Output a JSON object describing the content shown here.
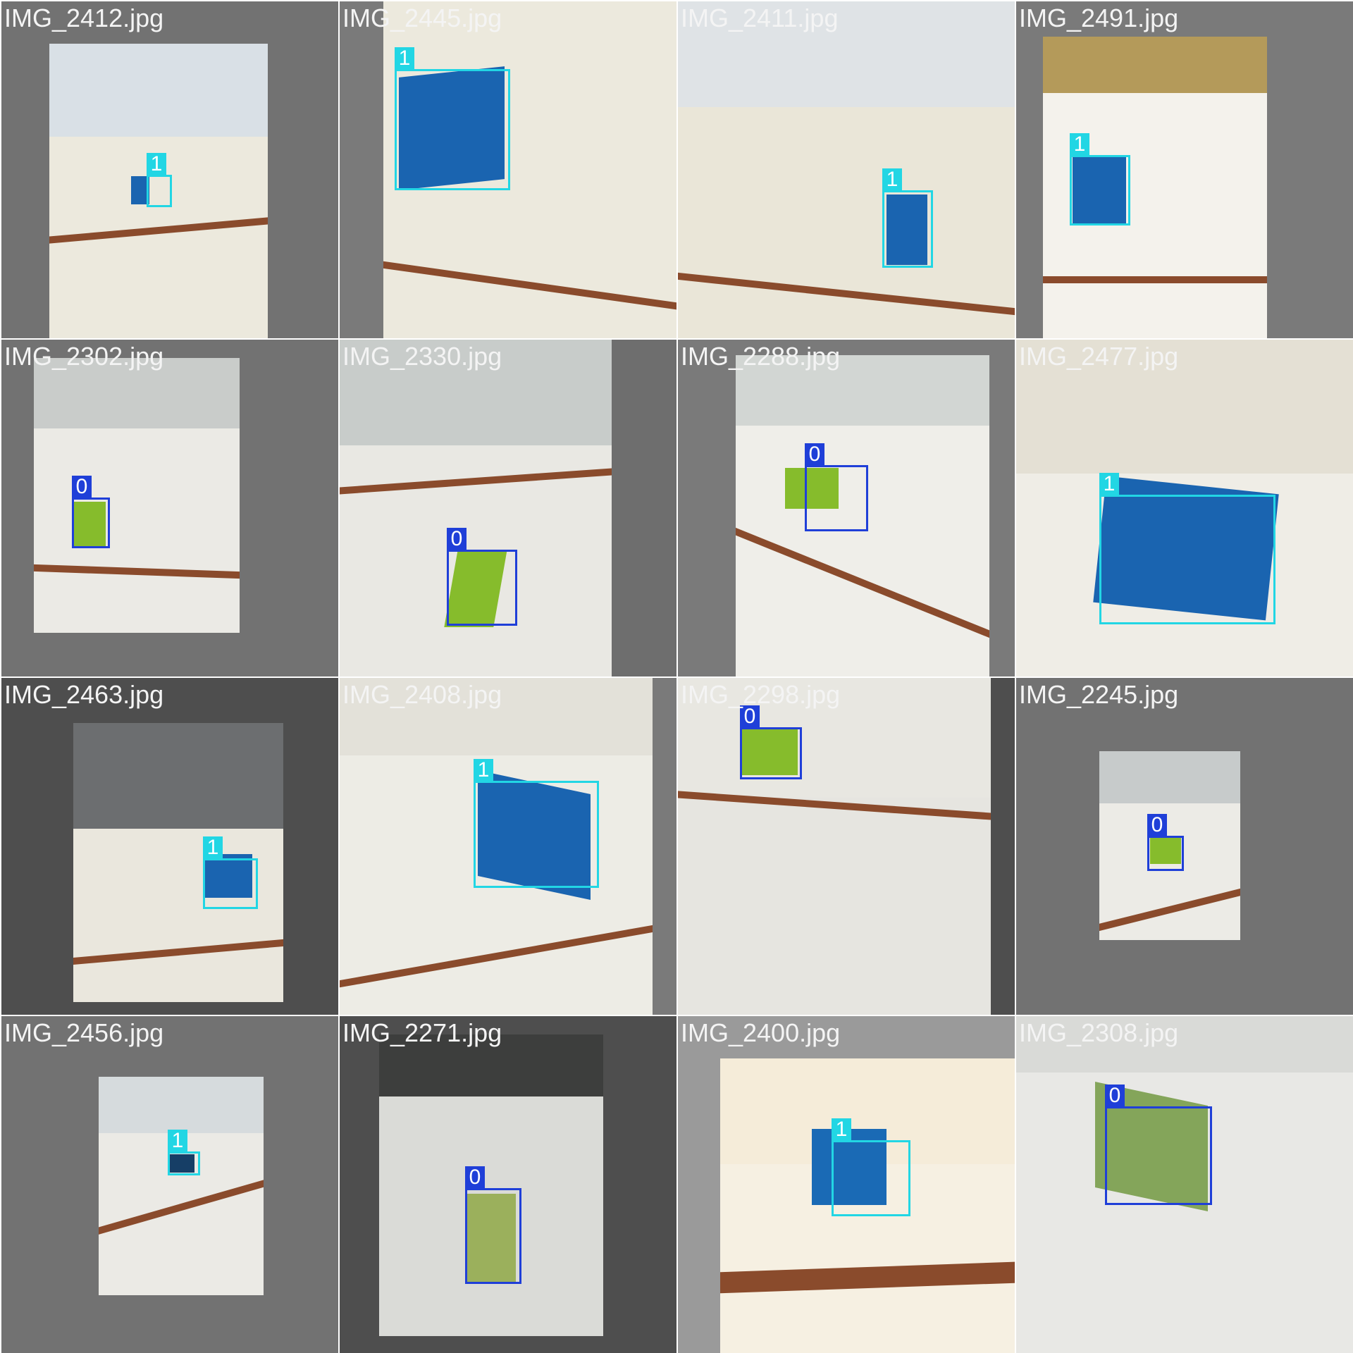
{
  "colors": {
    "class0_box": "#1f3fd8",
    "class1_box": "#22d6e4",
    "tile_bg_light": "#7a7a7a",
    "tile_bg_dark": "#4e4e4e",
    "filename_text": "#f4f4f4",
    "blue_block": "#1a64b0",
    "green_block": "#86bc2c"
  },
  "tiles": [
    {
      "filename": "IMG_2412.jpg",
      "class_label": "1",
      "block_color": "blue"
    },
    {
      "filename": "IMG_2445.jpg",
      "class_label": "1",
      "block_color": "blue"
    },
    {
      "filename": "IMG_2411.jpg",
      "class_label": "1",
      "block_color": "blue"
    },
    {
      "filename": "IMG_2491.jpg",
      "class_label": "1",
      "block_color": "blue"
    },
    {
      "filename": "IMG_2302.jpg",
      "class_label": "0",
      "block_color": "green"
    },
    {
      "filename": "IMG_2330.jpg",
      "class_label": "0",
      "block_color": "green"
    },
    {
      "filename": "IMG_2288.jpg",
      "class_label": "0",
      "block_color": "green"
    },
    {
      "filename": "IMG_2477.jpg",
      "class_label": "1",
      "block_color": "blue"
    },
    {
      "filename": "IMG_2463.jpg",
      "class_label": "1",
      "block_color": "blue"
    },
    {
      "filename": "IMG_2408.jpg",
      "class_label": "1",
      "block_color": "blue"
    },
    {
      "filename": "IMG_2298.jpg",
      "class_label": "0",
      "block_color": "green"
    },
    {
      "filename": "IMG_2245.jpg",
      "class_label": "0",
      "block_color": "green"
    },
    {
      "filename": "IMG_2456.jpg",
      "class_label": "1",
      "block_color": "blue"
    },
    {
      "filename": "IMG_2271.jpg",
      "class_label": "0",
      "block_color": "green"
    },
    {
      "filename": "IMG_2400.jpg",
      "class_label": "1",
      "block_color": "blue"
    },
    {
      "filename": "IMG_2308.jpg",
      "class_label": "0",
      "block_color": "green"
    }
  ]
}
